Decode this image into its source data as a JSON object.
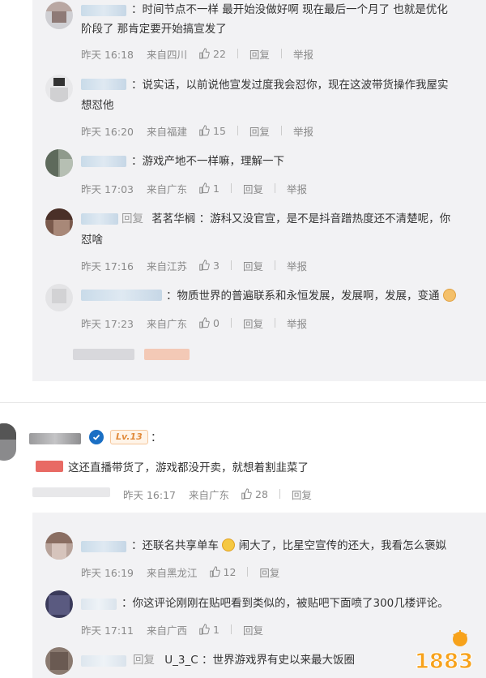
{
  "colors": {
    "panel": "#f2f2f4",
    "meta": "#8a8a8a",
    "verify": "#1a6fc4",
    "level": "#e08a3a"
  },
  "labels": {
    "reply": "回复",
    "report": "举报",
    "like_icon": "thumb-up-icon"
  },
  "replies_top": [
    {
      "line1": "：时间节点不一样 最开始没做好啊 现在最后一个月了 也就是优化",
      "line2": "阶段了 那肯定要开始搞宣发了",
      "time": "昨天 16:18",
      "loc": "来自四川",
      "likes": "22"
    },
    {
      "line1": "：说实话，以前说他宣发过度我会怼你，现在这波带货操作我屋实",
      "line2": "想怼他",
      "time": "昨天 16:20",
      "loc": "来自福建",
      "likes": "15"
    },
    {
      "line1": "：游戏产地不一样嘛，理解一下",
      "time": "昨天 17:03",
      "loc": "来自广东",
      "likes": "1"
    },
    {
      "reply_to": "茗茗华榈",
      "line1": "：游科又没官宣，是不是抖音蹭热度还不清楚呢，你",
      "line2": "怼啥",
      "time": "昨天 17:16",
      "loc": "来自江苏",
      "likes": "3"
    },
    {
      "line1": "：物质世界的普遍联系和永恒发展，发展啊，发展，变通",
      "time": "昨天 17:23",
      "loc": "来自广东",
      "likes": "0"
    }
  ],
  "main_comment": {
    "level": "Lv.13",
    "colon": "：",
    "text": "这还直播带货了，游戏都没开卖，就想着割韭菜了",
    "time": "昨天 16:17",
    "loc": "来自广东",
    "likes": "28"
  },
  "replies_bottom": [
    {
      "line1a": "：还联名共享单车",
      "line1b": "闹大了，比星空宣传的还大，我看怎么褒姒",
      "time": "昨天 16:19",
      "loc": "来自黑龙江",
      "likes": "12"
    },
    {
      "line1": "：你这评论刚刚在贴吧看到类似的，被贴吧下面喷了300几楼评论。",
      "time": "昨天 17:11",
      "loc": "来自广西",
      "likes": "1"
    },
    {
      "reply_to": "U_3_C",
      "line1": "：世界游戏界有史以来最大饭圈"
    }
  ],
  "watermark": "1883"
}
